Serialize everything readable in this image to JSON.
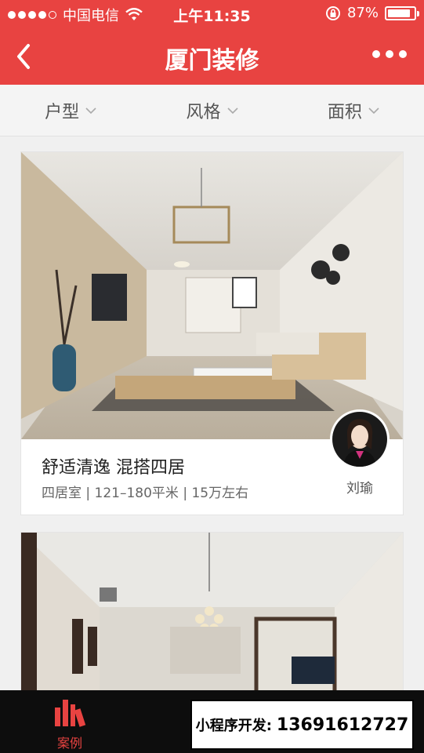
{
  "status": {
    "carrier": "中国电信",
    "time": "上午11:35",
    "battery": "87%",
    "battery_level": 0.87
  },
  "nav": {
    "title": "厦门装修",
    "back_icon": "chevron-left-icon",
    "more_icon": "more-dots-icon"
  },
  "filters": [
    {
      "label": "户型"
    },
    {
      "label": "风格"
    },
    {
      "label": "面积"
    }
  ],
  "cases": [
    {
      "title": "舒适清逸 混搭四居",
      "meta": "四居室 | 121–180平米 | 15万左右",
      "designer": "刘瑜"
    }
  ],
  "tabbar": {
    "active_tab": "案例",
    "active_color": "#e84341"
  },
  "watermark": {
    "label": "小程序开发:",
    "phone": "13691612727"
  },
  "colors": {
    "brand": "#e84341",
    "background": "#f0f0f0"
  }
}
